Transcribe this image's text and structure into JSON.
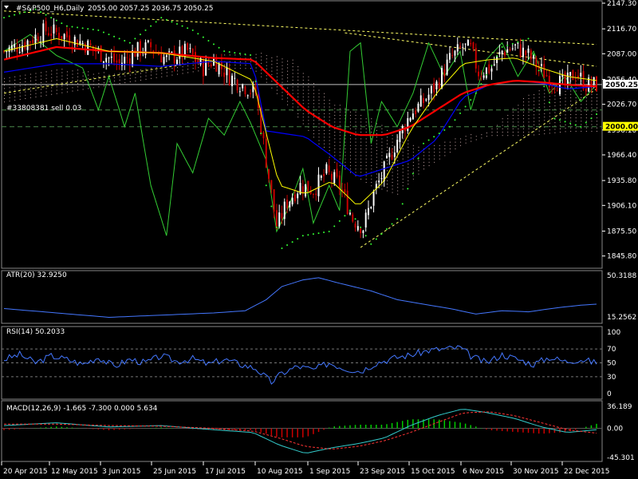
{
  "header": {
    "symbol": "#S&P500_H6,Daily",
    "ohlc": "2055.00 2057.25 2036.75 2050.25"
  },
  "order_label": "#33808381 sell 0.03",
  "price_boxes": {
    "current": "2050.25",
    "level": "2000.00"
  },
  "indicators": {
    "atr": {
      "label": "ATR(20) 32.9250",
      "ticks": [
        "50.3188",
        "15.2562"
      ]
    },
    "rsi": {
      "label": "RSI(14) 50.2033",
      "ticks": [
        "70",
        "50",
        "30",
        "0"
      ],
      "top_tick": "100"
    },
    "macd": {
      "label": "MACD(12,26,9) -1.665 -7.300 0.000 5.634",
      "ticks": [
        "36.189",
        "0.00",
        "-45.301"
      ]
    }
  },
  "colors": {
    "bull_body": "#ffffff",
    "bear_body": "#cc0000",
    "ma_fast": "#ffff00",
    "ma_slow": "#ff0000",
    "ma_mid": "#0000ff",
    "oscillator": "#33cc33",
    "atr_line": "#4477ff",
    "rsi_line": "#4477ff",
    "sar": "#33ff33",
    "trend": "#ffff66",
    "grid": "#5a5a5a"
  },
  "chart_data": [
    {
      "type": "candlestick",
      "title": "#S&P500_H6,Daily",
      "ylim": [
        1835,
        2147.3
      ],
      "y_ticks": [
        2147.3,
        2116.7,
        2087.0,
        2056.4,
        2026.7,
        1996.1,
        1966.4,
        1935.8,
        1906.1,
        1875.5,
        1845.8
      ],
      "x_ticks": [
        "20 Apr 2015",
        "12 May 2015",
        "3 Jun 2015",
        "25 Jun 2015",
        "17 Jul 2015",
        "10 Aug 2015",
        "1 Sep 2015",
        "23 Sep 2015",
        "15 Oct 2015",
        "6 Nov 2015",
        "30 Nov 2015",
        "22 Dec 2015"
      ],
      "close_path": [
        [
          0,
          2090
        ],
        [
          8,
          2100
        ],
        [
          16,
          2115
        ],
        [
          22,
          2110
        ],
        [
          30,
          2100
        ],
        [
          38,
          2085
        ],
        [
          44,
          2075
        ],
        [
          50,
          2090
        ],
        [
          56,
          2095
        ],
        [
          62,
          2080
        ],
        [
          70,
          2090
        ],
        [
          76,
          2070
        ],
        [
          80,
          2080
        ],
        [
          86,
          2060
        ],
        [
          91,
          2050
        ],
        [
          96,
          2040
        ],
        [
          100,
          1960
        ],
        [
          104,
          1880
        ],
        [
          108,
          1910
        ],
        [
          113,
          1930
        ],
        [
          118,
          1925
        ],
        [
          123,
          1945
        ],
        [
          128,
          1930
        ],
        [
          133,
          1890
        ],
        [
          137,
          1880
        ],
        [
          141,
          1920
        ],
        [
          146,
          1955
        ],
        [
          150,
          1985
        ],
        [
          155,
          2015
        ],
        [
          160,
          2030
        ],
        [
          165,
          2050
        ],
        [
          170,
          2080
        ],
        [
          175,
          2095
        ],
        [
          178,
          2092
        ],
        [
          181,
          2065
        ],
        [
          186,
          2070
        ],
        [
          190,
          2090
        ],
        [
          195,
          2095
        ],
        [
          200,
          2085
        ],
        [
          204,
          2070
        ],
        [
          209,
          2055
        ],
        [
          214,
          2050
        ],
        [
          218,
          2065
        ],
        [
          222,
          2050
        ],
        [
          226,
          2050
        ]
      ],
      "ma_fast": [
        [
          0,
          2090
        ],
        [
          20,
          2105
        ],
        [
          40,
          2090
        ],
        [
          60,
          2088
        ],
        [
          80,
          2078
        ],
        [
          95,
          2055
        ],
        [
          105,
          1930
        ],
        [
          115,
          1920
        ],
        [
          125,
          1935
        ],
        [
          135,
          1905
        ],
        [
          145,
          1935
        ],
        [
          155,
          1995
        ],
        [
          165,
          2040
        ],
        [
          175,
          2075
        ],
        [
          185,
          2080
        ],
        [
          195,
          2082
        ],
        [
          205,
          2070
        ],
        [
          215,
          2060
        ],
        [
          226,
          2055
        ]
      ],
      "ma_slow": [
        [
          0,
          2080
        ],
        [
          20,
          2095
        ],
        [
          40,
          2090
        ],
        [
          60,
          2088
        ],
        [
          80,
          2082
        ],
        [
          95,
          2080
        ],
        [
          105,
          2050
        ],
        [
          115,
          2020
        ],
        [
          125,
          2000
        ],
        [
          135,
          1990
        ],
        [
          145,
          1990
        ],
        [
          155,
          2000
        ],
        [
          165,
          2020
        ],
        [
          175,
          2040
        ],
        [
          185,
          2050
        ],
        [
          195,
          2055
        ],
        [
          205,
          2053
        ],
        [
          215,
          2050
        ],
        [
          226,
          2048
        ]
      ],
      "ma_mid": [
        [
          0,
          2065
        ],
        [
          20,
          2075
        ],
        [
          40,
          2075
        ],
        [
          60,
          2072
        ],
        [
          80,
          2078
        ],
        [
          95,
          2075
        ],
        [
          100,
          1995
        ],
        [
          115,
          1988
        ],
        [
          125,
          1965
        ],
        [
          135,
          1940
        ],
        [
          145,
          1950
        ],
        [
          155,
          1960
        ],
        [
          165,
          1985
        ],
        [
          175,
          2035
        ],
        [
          185,
          2050
        ],
        [
          195,
          2055
        ],
        [
          205,
          2052
        ],
        [
          215,
          2045
        ],
        [
          226,
          2048
        ]
      ],
      "oscillator": [
        [
          0,
          2090
        ],
        [
          10,
          2110
        ],
        [
          20,
          2085
        ],
        [
          30,
          2070
        ],
        [
          36,
          2020
        ],
        [
          40,
          2060
        ],
        [
          46,
          2000
        ],
        [
          50,
          2040
        ],
        [
          56,
          1930
        ],
        [
          62,
          1870
        ],
        [
          66,
          1980
        ],
        [
          72,
          1945
        ],
        [
          78,
          2010
        ],
        [
          84,
          1990
        ],
        [
          90,
          2030
        ],
        [
          94,
          2005
        ],
        [
          100,
          1960
        ],
        [
          104,
          1875
        ],
        [
          108,
          1900
        ],
        [
          114,
          1950
        ],
        [
          118,
          1885
        ],
        [
          124,
          1930
        ],
        [
          128,
          1900
        ],
        [
          132,
          2090
        ],
        [
          136,
          2100
        ],
        [
          140,
          1980
        ],
        [
          144,
          2030
        ],
        [
          150,
          2000
        ],
        [
          156,
          2040
        ],
        [
          162,
          2100
        ],
        [
          168,
          2060
        ],
        [
          174,
          2090
        ],
        [
          178,
          2020
        ],
        [
          184,
          2080
        ],
        [
          190,
          2100
        ],
        [
          196,
          2060
        ],
        [
          202,
          2090
        ],
        [
          208,
          2040
        ],
        [
          214,
          2060
        ],
        [
          220,
          2030
        ],
        [
          226,
          2050
        ]
      ],
      "sar": [
        [
          0,
          2130
        ],
        [
          12,
          2140
        ],
        [
          24,
          2120
        ],
        [
          36,
          2115
        ],
        [
          48,
          2100
        ],
        [
          60,
          2130
        ],
        [
          72,
          2115
        ],
        [
          84,
          2090
        ],
        [
          95,
          2085
        ],
        [
          100,
          1930
        ],
        [
          106,
          1855
        ],
        [
          114,
          1870
        ],
        [
          124,
          1875
        ],
        [
          132,
          1900
        ],
        [
          140,
          1860
        ],
        [
          150,
          1890
        ],
        [
          160,
          1980
        ],
        [
          170,
          2000
        ],
        [
          180,
          2040
        ],
        [
          190,
          2095
        ],
        [
          200,
          2105
        ],
        [
          210,
          2010
        ],
        [
          220,
          2000
        ],
        [
          226,
          2015
        ]
      ],
      "trend_lines": [
        {
          "name": "resistance-1",
          "from": [
            0,
            2138
          ],
          "to": [
            226,
            2098
          ]
        },
        {
          "name": "resistance-2",
          "from": [
            130,
            2112
          ],
          "to": [
            226,
            2072
          ]
        },
        {
          "name": "support",
          "from": [
            136,
            1856
          ],
          "to": [
            226,
            2045
          ]
        },
        {
          "name": "lower-channel",
          "from": [
            0,
            2040
          ],
          "to": [
            70,
            2075
          ]
        }
      ],
      "h_levels": [
        {
          "price": 2050.25
        },
        {
          "price": 2020
        },
        {
          "price": 2000.0
        }
      ]
    },
    {
      "type": "line",
      "title": "ATR(20) 32.9250",
      "ylim": [
        10,
        55
      ],
      "series": [
        {
          "values": [
            [
              0,
              22
            ],
            [
              20,
              18
            ],
            [
              40,
              14
            ],
            [
              60,
              16
            ],
            [
              80,
              18
            ],
            [
              92,
              20
            ],
            [
              100,
              30
            ],
            [
              106,
              42
            ],
            [
              114,
              48
            ],
            [
              120,
              50
            ],
            [
              128,
              45
            ],
            [
              140,
              38
            ],
            [
              150,
              30
            ],
            [
              160,
              26
            ],
            [
              170,
              22
            ],
            [
              180,
              17
            ],
            [
              190,
              20
            ],
            [
              200,
              19
            ],
            [
              212,
              23
            ],
            [
              220,
              25
            ],
            [
              226,
              26
            ]
          ]
        }
      ]
    },
    {
      "type": "line",
      "title": "RSI(14) 50.2033",
      "ylim": [
        0,
        100
      ],
      "levels": [
        70,
        50,
        30
      ],
      "series": [
        {
          "values": [
            [
              0,
              55
            ],
            [
              6,
              62
            ],
            [
              12,
              50
            ],
            [
              18,
              60
            ],
            [
              24,
              55
            ],
            [
              30,
              48
            ],
            [
              36,
              58
            ],
            [
              42,
              45
            ],
            [
              48,
              55
            ],
            [
              54,
              50
            ],
            [
              60,
              60
            ],
            [
              66,
              52
            ],
            [
              72,
              56
            ],
            [
              78,
              48
            ],
            [
              84,
              55
            ],
            [
              90,
              48
            ],
            [
              96,
              42
            ],
            [
              102,
              22
            ],
            [
              106,
              35
            ],
            [
              112,
              45
            ],
            [
              118,
              40
            ],
            [
              124,
              50
            ],
            [
              130,
              42
            ],
            [
              136,
              38
            ],
            [
              142,
              50
            ],
            [
              150,
              58
            ],
            [
              156,
              62
            ],
            [
              162,
              68
            ],
            [
              168,
              70
            ],
            [
              174,
              72
            ],
            [
              178,
              60
            ],
            [
              184,
              50
            ],
            [
              190,
              62
            ],
            [
              196,
              55
            ],
            [
              202,
              48
            ],
            [
              208,
              58
            ],
            [
              214,
              52
            ],
            [
              220,
              55
            ],
            [
              226,
              50
            ]
          ]
        }
      ]
    },
    {
      "type": "bar",
      "title": "MACD(12,26,9) -1.665 -7.300 0.000 5.634",
      "ylim": [
        -45.3,
        36.2
      ],
      "series": [
        {
          "values": [
            [
              0,
              4
            ],
            [
              20,
              8
            ],
            [
              40,
              2
            ],
            [
              60,
              4
            ],
            [
              80,
              -2
            ],
            [
              95,
              -6
            ],
            [
              105,
              -24
            ],
            [
              115,
              -36
            ],
            [
              125,
              -28
            ],
            [
              135,
              -22
            ],
            [
              145,
              -14
            ],
            [
              155,
              4
            ],
            [
              165,
              18
            ],
            [
              175,
              28
            ],
            [
              185,
              22
            ],
            [
              195,
              14
            ],
            [
              205,
              2
            ],
            [
              215,
              -6
            ],
            [
              226,
              -2
            ]
          ]
        },
        {
          "values": [
            [
              0,
              6
            ],
            [
              20,
              6
            ],
            [
              40,
              4
            ],
            [
              60,
              3
            ],
            [
              80,
              0
            ],
            [
              95,
              -4
            ],
            [
              105,
              -14
            ],
            [
              115,
              -26
            ],
            [
              125,
              -30
            ],
            [
              135,
              -26
            ],
            [
              145,
              -18
            ],
            [
              155,
              -6
            ],
            [
              165,
              8
            ],
            [
              175,
              22
            ],
            [
              185,
              24
            ],
            [
              195,
              18
            ],
            [
              205,
              8
            ],
            [
              215,
              -2
            ],
            [
              226,
              -7
            ]
          ]
        }
      ]
    }
  ]
}
